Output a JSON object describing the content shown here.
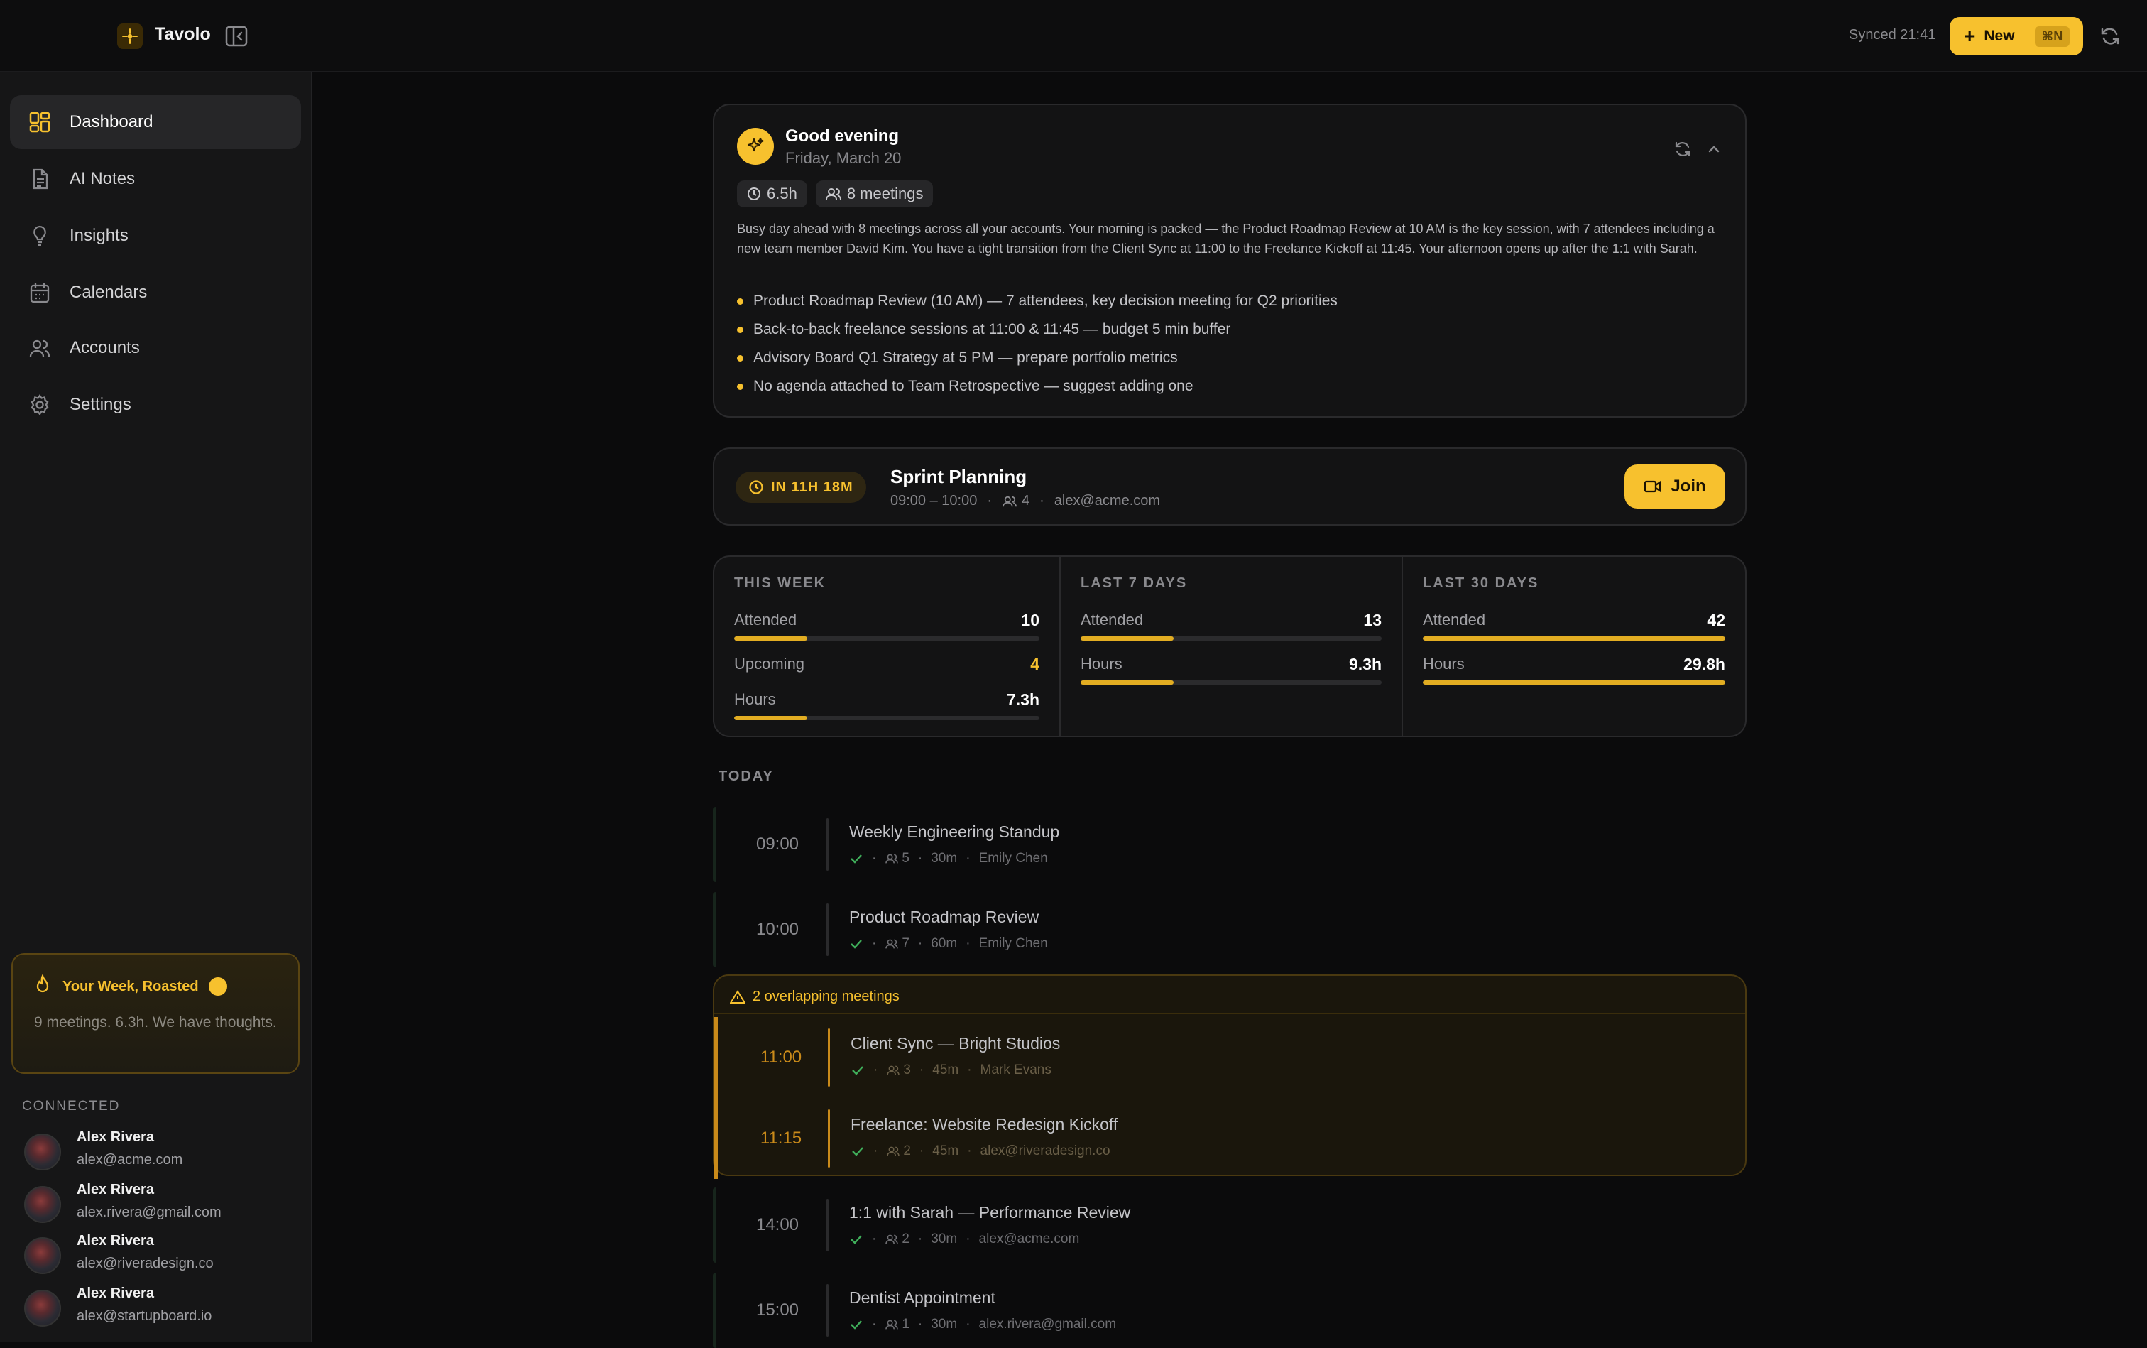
{
  "app": {
    "name": "Tavolo",
    "synced": "Synced 21:41",
    "new_label": "New",
    "new_shortcut": "⌘N",
    "accent": "#f7c12e"
  },
  "sidebar": {
    "items": [
      {
        "label": "Dashboard",
        "icon": "dashboard-icon"
      },
      {
        "label": "AI Notes",
        "icon": "document-icon"
      },
      {
        "label": "Insights",
        "icon": "lightbulb-icon"
      },
      {
        "label": "Calendars",
        "icon": "calendar-icon"
      },
      {
        "label": "Accounts",
        "icon": "users-icon"
      },
      {
        "label": "Settings",
        "icon": "gear-icon"
      }
    ],
    "roast": {
      "title": "Your Week, Roasted",
      "body": "9 meetings. 6.3h. We have thoughts."
    },
    "connected_label": "CONNECTED",
    "accounts": [
      {
        "name": "Alex Rivera",
        "email": "alex@acme.com"
      },
      {
        "name": "Alex Rivera",
        "email": "alex.rivera@gmail.com"
      },
      {
        "name": "Alex Rivera",
        "email": "alex@riveradesign.co"
      },
      {
        "name": "Alex Rivera",
        "email": "alex@startupboard.io"
      }
    ]
  },
  "brief": {
    "greeting": "Good evening",
    "date": "Friday, March 20",
    "chip_hours": "6.5h",
    "chip_meetings": "8 meetings",
    "summary": "Busy day ahead with 8 meetings across all your accounts. Your morning is packed — the Product Roadmap Review at 10 AM is the key session, with 7 attendees including a new team member David Kim. You have a tight transition from the Client Sync at 11:00 to the Freelance Kickoff at 11:45. Your afternoon opens up after the 1:1 with Sarah.",
    "bullets": [
      "Product Roadmap Review (10 AM) — 7 attendees, key decision meeting for Q2 priorities",
      "Back-to-back freelance sessions at 11:00 & 11:45 — budget 5 min buffer",
      "Advisory Board Q1 Strategy at 5 PM — prepare portfolio metrics",
      "No agenda attached to Team Retrospective — suggest adding one"
    ]
  },
  "next_meeting": {
    "countdown": "IN 11H 18M",
    "title": "Sprint Planning",
    "time": "09:00 – 10:00",
    "attendees": "4",
    "account": "alex@acme.com",
    "join_label": "Join"
  },
  "stats": {
    "this_week": {
      "label": "THIS WEEK",
      "attended_label": "Attended",
      "attended": "10",
      "attended_fill": 0.24,
      "upcoming_label": "Upcoming",
      "upcoming": "4",
      "hours_label": "Hours",
      "hours": "7.3h",
      "hours_fill": 0.24
    },
    "last_7": {
      "label": "LAST 7 DAYS",
      "attended_label": "Attended",
      "attended": "13",
      "attended_fill": 0.31,
      "hours_label": "Hours",
      "hours": "9.3h",
      "hours_fill": 0.31
    },
    "last_30": {
      "label": "LAST 30 DAYS",
      "attended_label": "Attended",
      "attended": "42",
      "attended_fill": 1.0,
      "hours_label": "Hours",
      "hours": "29.8h",
      "hours_fill": 1.0
    }
  },
  "today": {
    "label": "TODAY",
    "meetings": [
      {
        "time": "09:00",
        "title": "Weekly Engineering Standup",
        "attendees": "5",
        "duration": "30m",
        "who": "Emily Chen"
      },
      {
        "time": "10:00",
        "title": "Product Roadmap Review",
        "attendees": "7",
        "duration": "60m",
        "who": "Emily Chen"
      },
      {
        "time": "14:00",
        "title": "1:1 with Sarah — Performance Review",
        "attendees": "2",
        "duration": "30m",
        "who": "alex@acme.com"
      },
      {
        "time": "15:00",
        "title": "Dentist Appointment",
        "attendees": "1",
        "duration": "30m",
        "who": "alex.rivera@gmail.com"
      }
    ],
    "overlap": {
      "label": "2 overlapping meetings",
      "meetings": [
        {
          "time": "11:00",
          "title": "Client Sync — Bright Studios",
          "attendees": "3",
          "duration": "45m",
          "who": "Mark Evans"
        },
        {
          "time": "11:15",
          "title": "Freelance: Website Redesign Kickoff",
          "attendees": "2",
          "duration": "45m",
          "who": "alex@riveradesign.co"
        }
      ]
    }
  }
}
